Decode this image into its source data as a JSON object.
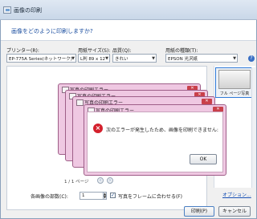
{
  "window": {
    "title": "画像の印刷"
  },
  "question": "画像をどのように印刷しますか?",
  "printer": {
    "label": "プリンター(R):",
    "value": "EP-775A Series(ネットワーク)"
  },
  "paper_size": {
    "label": "用紙サイズ(S):",
    "value": "L判 89 x 12"
  },
  "quality": {
    "label": "品質(Q):",
    "value": "きれい"
  },
  "paper_type": {
    "label": "用紙の種類(T):",
    "value": "EPSON 光沢紙"
  },
  "preview": {
    "page_indicator": "1 / 1 ページ"
  },
  "thumbnail": {
    "caption": "フル ページ写真"
  },
  "copies": {
    "label": "各画像の部数(C):",
    "value": "1"
  },
  "fit_frame": {
    "label": "写真をフレームに合わせる(F)",
    "checked": true
  },
  "options_link": "オプション...",
  "buttons": {
    "print": "印刷(P)",
    "cancel": "キャンセル"
  },
  "error_dialogs": {
    "title": "写真の印刷エラー",
    "message": "次のエラーが発生したため、画像を印刷できません:",
    "ok": "OK",
    "stacked_count": 4,
    "accent_color": "#efc8e2",
    "error_icon_color": "#d4202c"
  }
}
